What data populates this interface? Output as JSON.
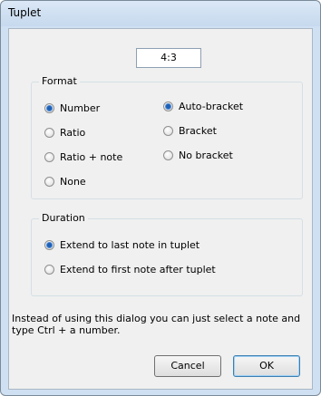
{
  "window": {
    "title": "Tuplet"
  },
  "ratio": {
    "value": "4:3"
  },
  "format": {
    "legend": "Format",
    "number_options": [
      {
        "label": "Number",
        "selected": true
      },
      {
        "label": "Ratio",
        "selected": false
      },
      {
        "label": "Ratio + note",
        "selected": false
      },
      {
        "label": "None",
        "selected": false
      }
    ],
    "bracket_options": [
      {
        "label": "Auto-bracket",
        "selected": true
      },
      {
        "label": "Bracket",
        "selected": false
      },
      {
        "label": "No bracket",
        "selected": false
      }
    ]
  },
  "duration": {
    "legend": "Duration",
    "options": [
      {
        "label": "Extend to last note in tuplet",
        "selected": true
      },
      {
        "label": "Extend to first note after tuplet",
        "selected": false
      }
    ]
  },
  "hint": "Instead of using this dialog you can just select a note and type Ctrl + a number.",
  "buttons": {
    "cancel": "Cancel",
    "ok": "OK"
  }
}
